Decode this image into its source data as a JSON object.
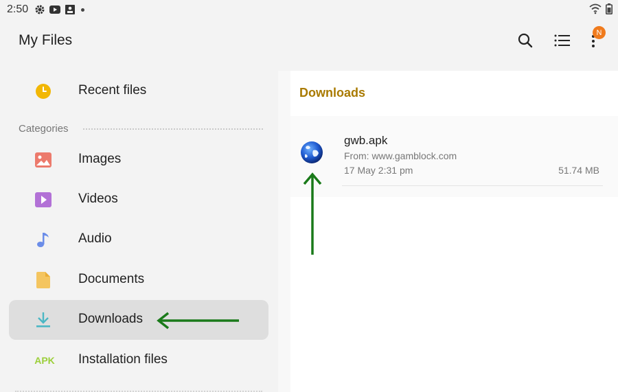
{
  "status_bar": {
    "time": "2:50",
    "icons": [
      "gear-icon",
      "youtube-icon",
      "photo-icon",
      "dot-icon",
      "wifi-icon",
      "battery-icon"
    ]
  },
  "app_bar": {
    "title": "My Files",
    "notification_badge": "N",
    "actions": [
      "search-icon",
      "list-view-icon",
      "more-options-icon"
    ]
  },
  "sidebar": {
    "recent": {
      "label": "Recent files",
      "icon": "clock-icon"
    },
    "categories_label": "Categories",
    "items": [
      {
        "label": "Images",
        "icon": "image-icon",
        "selected": false
      },
      {
        "label": "Videos",
        "icon": "video-icon",
        "selected": false
      },
      {
        "label": "Audio",
        "icon": "music-note-icon",
        "selected": false
      },
      {
        "label": "Documents",
        "icon": "document-icon",
        "selected": false
      },
      {
        "label": "Downloads",
        "icon": "download-icon",
        "selected": true
      },
      {
        "label": "Installation files",
        "icon_text": "APK",
        "selected": false
      }
    ]
  },
  "main": {
    "section_title": "Downloads",
    "files": [
      {
        "name": "gwb.apk",
        "source": "From: www.gamblock.com",
        "date": "17 May 2:31 pm",
        "size": "51.74 MB",
        "icon": "globe-icon"
      }
    ]
  },
  "colors": {
    "accent_title": "#a97a00",
    "selected_bg": "#dedede",
    "annotation_arrow": "#1a7a1a",
    "badge": "#f07b1d"
  }
}
